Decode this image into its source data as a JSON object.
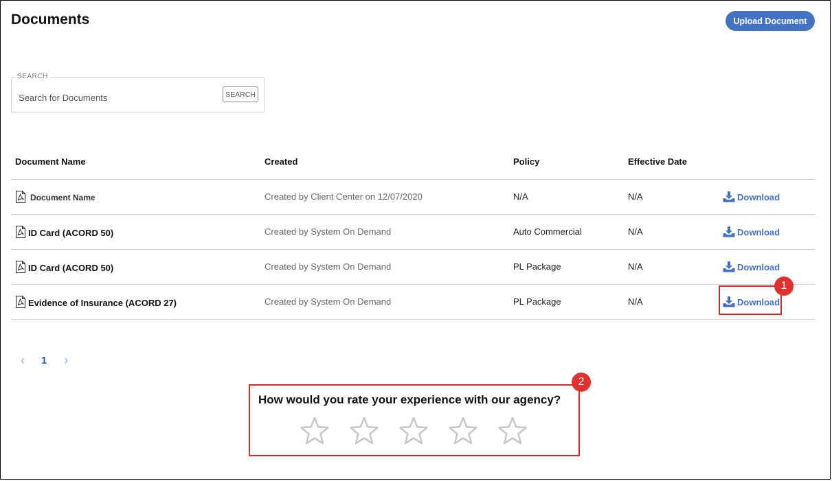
{
  "header": {
    "title": "Documents",
    "upload_label": "Upload Document"
  },
  "search": {
    "legend": "SEARCH",
    "placeholder": "Search for Documents",
    "button_label": "SEARCH"
  },
  "table": {
    "headers": {
      "name": "Document Name",
      "created": "Created",
      "policy": "Policy",
      "effective": "Effective Date"
    },
    "rows": [
      {
        "name": "Document Name",
        "created": "Created by Client Center on 12/07/2020",
        "policy": "N/A",
        "effective": "N/A",
        "action": "Download"
      },
      {
        "name": "ID Card (ACORD 50)",
        "created": "Created by System On Demand",
        "policy": "Auto Commercial",
        "effective": "N/A",
        "action": "Download"
      },
      {
        "name": "ID Card (ACORD 50)",
        "created": "Created by System On Demand",
        "policy": "PL Package",
        "effective": "N/A",
        "action": "Download"
      },
      {
        "name": "Evidence of Insurance (ACORD 27)",
        "created": "Created by System On Demand",
        "policy": "PL Package",
        "effective": "N/A",
        "action": "Download"
      }
    ]
  },
  "pagination": {
    "current_page": "1"
  },
  "rating": {
    "question": "How would you rate your experience with our agency?",
    "stars_total": 5,
    "stars_selected": 0
  },
  "annotations": {
    "badge_1": "1",
    "badge_2": "2"
  },
  "colors": {
    "accent": "#4472c4",
    "highlight": "#d42a2a",
    "badge": "#e0312f"
  }
}
